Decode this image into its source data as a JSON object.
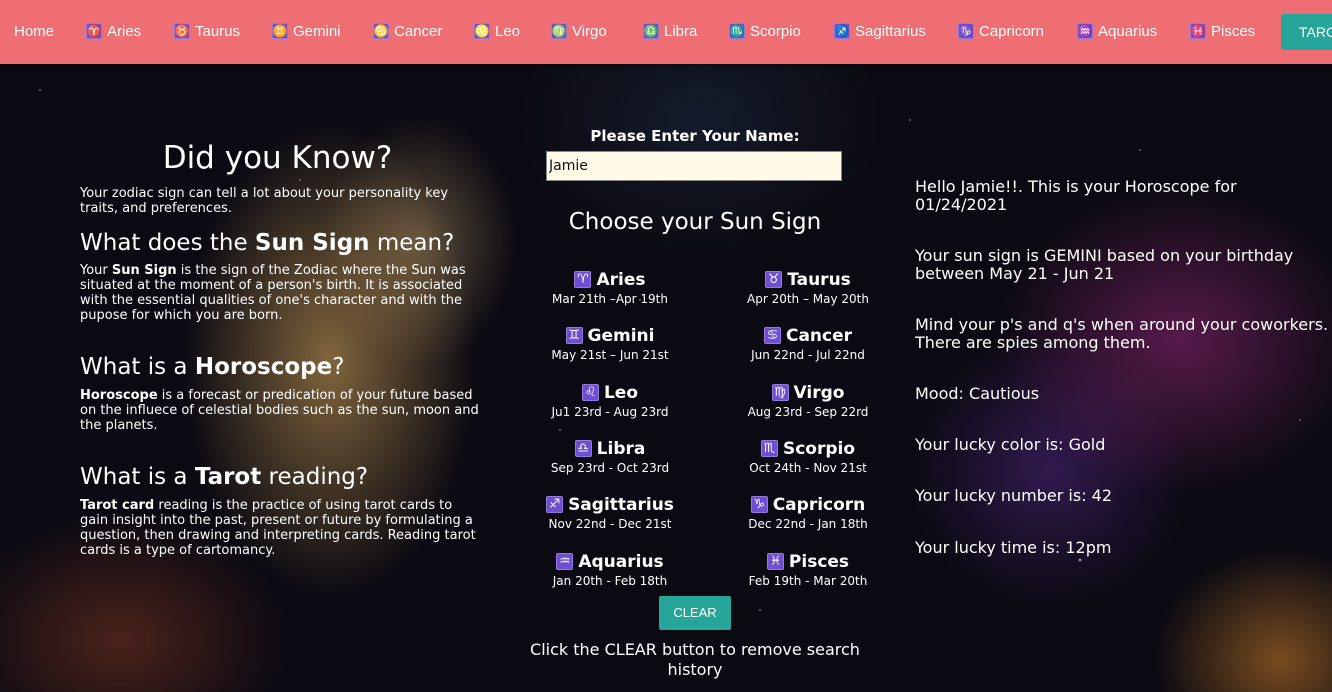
{
  "nav": {
    "home": "Home",
    "items": [
      {
        "icon": "♈",
        "label": "Aries"
      },
      {
        "icon": "♉",
        "label": "Taurus"
      },
      {
        "icon": "♊",
        "label": "Gemini"
      },
      {
        "icon": "♋",
        "label": "Cancer"
      },
      {
        "icon": "♌",
        "label": "Leo"
      },
      {
        "icon": "♍",
        "label": "Virgo"
      },
      {
        "icon": "♎",
        "label": "Libra"
      },
      {
        "icon": "♏",
        "label": "Scorpio"
      },
      {
        "icon": "♐",
        "label": "Sagittarius"
      },
      {
        "icon": "♑",
        "label": "Capricorn"
      },
      {
        "icon": "♒",
        "label": "Aquarius"
      },
      {
        "icon": "♓",
        "label": "Pisces"
      }
    ],
    "tarot_button": "TAROT"
  },
  "left": {
    "did_you_know": "Did you Know?",
    "intro": "Your zodiac sign can tell a lot about your personality key traits, and preferences.",
    "sun_q_pre": "What does the ",
    "sun_q_bold": "Sun Sign",
    "sun_q_post": " mean?",
    "sun_p_bold": "Sun Sign",
    "sun_p_pre": "Your ",
    "sun_p_post": " is the sign of the Zodiac where the Sun was situated at the moment of a person's birth. It is associated with the essential qualities of one's character and with the pupose for which you are born.",
    "horo_q_pre": "What is a ",
    "horo_q_bold": "Horoscope",
    "horo_q_post": "?",
    "horo_p_bold": "Horoscope",
    "horo_p_post": " is a forecast or predication of your future based on the influece of celestial bodies such as the sun, moon and the planets.",
    "tarot_q_pre": "What is a ",
    "tarot_q_bold": "Tarot",
    "tarot_q_post": " reading?",
    "tarot_p_bold": "Tarot card",
    "tarot_p_post": " reading is the practice of using tarot cards to gain insight into the past, present or future by formulating a question, then drawing and interpreting cards. Reading tarot cards is a type of cartomancy."
  },
  "center": {
    "name_label": "Please Enter Your Name:",
    "name_value": "Jamie",
    "choose_title": "Choose your Sun Sign",
    "signs": [
      {
        "icon": "♈",
        "name": "Aries",
        "dates": "Mar 21th –Apr 19th"
      },
      {
        "icon": "♉",
        "name": "Taurus",
        "dates": "Apr 20th – May 20th"
      },
      {
        "icon": "♊",
        "name": "Gemini",
        "dates": "May 21st – Jun 21st"
      },
      {
        "icon": "♋",
        "name": "Cancer",
        "dates": "Jun 22nd - Jul 22nd"
      },
      {
        "icon": "♌",
        "name": "Leo",
        "dates": "Ju1 23rd - Aug 23rd"
      },
      {
        "icon": "♍",
        "name": "Virgo",
        "dates": "Aug 23rd - Sep 22rd"
      },
      {
        "icon": "♎",
        "name": "Libra",
        "dates": "Sep 23rd - Oct 23rd"
      },
      {
        "icon": "♏",
        "name": "Scorpio",
        "dates": "Oct 24th - Nov 21st"
      },
      {
        "icon": "♐",
        "name": "Sagittarius",
        "dates": "Nov 22nd - Dec 21st"
      },
      {
        "icon": "♑",
        "name": "Capricorn",
        "dates": "Dec 22nd - Jan 18th"
      },
      {
        "icon": "♒",
        "name": "Aquarius",
        "dates": "Jan 20th - Feb 18th"
      },
      {
        "icon": "♓",
        "name": "Pisces",
        "dates": "Feb 19th - Mar 20th"
      }
    ],
    "clear_button": "CLEAR",
    "clear_note": "Click the CLEAR button to remove search history"
  },
  "result": {
    "greeting": "Hello Jamie!!. This is your Horoscope for 01/24/2021",
    "sun_sign": "Your sun sign is GEMINI based on your birthday between May 21 - Jun 21",
    "reading": "Mind your p's and q's when around your coworkers. There are spies among them.",
    "mood": "Mood: Cautious",
    "lucky_color": "Your lucky color is: Gold",
    "lucky_number": "Your lucky number is: 42",
    "lucky_time": "Your lucky time is: 12pm"
  },
  "colors": {
    "nav": "#ee6e73",
    "button": "#26a69a",
    "icon_bg": "#6e4fd2"
  }
}
